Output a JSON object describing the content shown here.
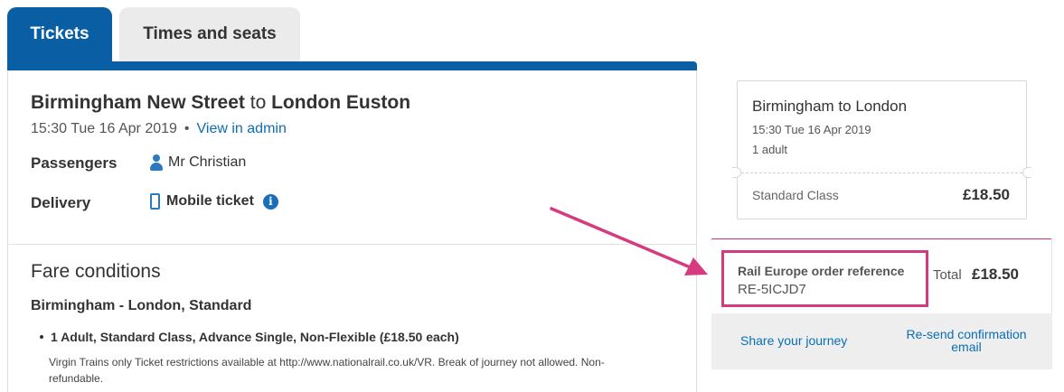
{
  "tabs": [
    {
      "label": "Tickets",
      "active": true
    },
    {
      "label": "Times and seats",
      "active": false
    }
  ],
  "journey": {
    "origin": "Birmingham New Street",
    "connector": "to",
    "destination": "London Euston",
    "datetime": "15:30 Tue 16 Apr 2019",
    "separator": "•",
    "admin_link": "View in admin"
  },
  "passengers": {
    "label": "Passengers",
    "value": "Mr Christian",
    "icon": "person-icon"
  },
  "delivery": {
    "label": "Delivery",
    "value": "Mobile ticket",
    "icon": "mobile-phone-icon",
    "info_icon": "info-icon",
    "info_glyph": "i"
  },
  "fare_conditions": {
    "heading": "Fare conditions",
    "route": "Birmingham - London, Standard",
    "item": "1 Adult, Standard Class, Advance Single, Non-Flexible (£18.50 each)",
    "description": "Virgin Trains only Ticket restrictions available at http://www.nationalrail.co.uk/VR. Break of journey not allowed. Non-refundable."
  },
  "summary": {
    "title": "Birmingham to London",
    "datetime": "15:30 Tue 16 Apr 2019",
    "passengers": "1 adult",
    "class": "Standard Class",
    "price": "£18.50"
  },
  "order": {
    "reference_label": "Rail Europe order reference",
    "reference_value": "RE-5ICJD7",
    "total_label": "Total",
    "total_value": "£18.50"
  },
  "actions": {
    "share": "Share your journey",
    "resend": "Re-send confirmation email"
  },
  "colors": {
    "brand_blue": "#0a5fa4",
    "link_blue": "#0a6eb5",
    "highlight_pink": "#d23c7e"
  }
}
